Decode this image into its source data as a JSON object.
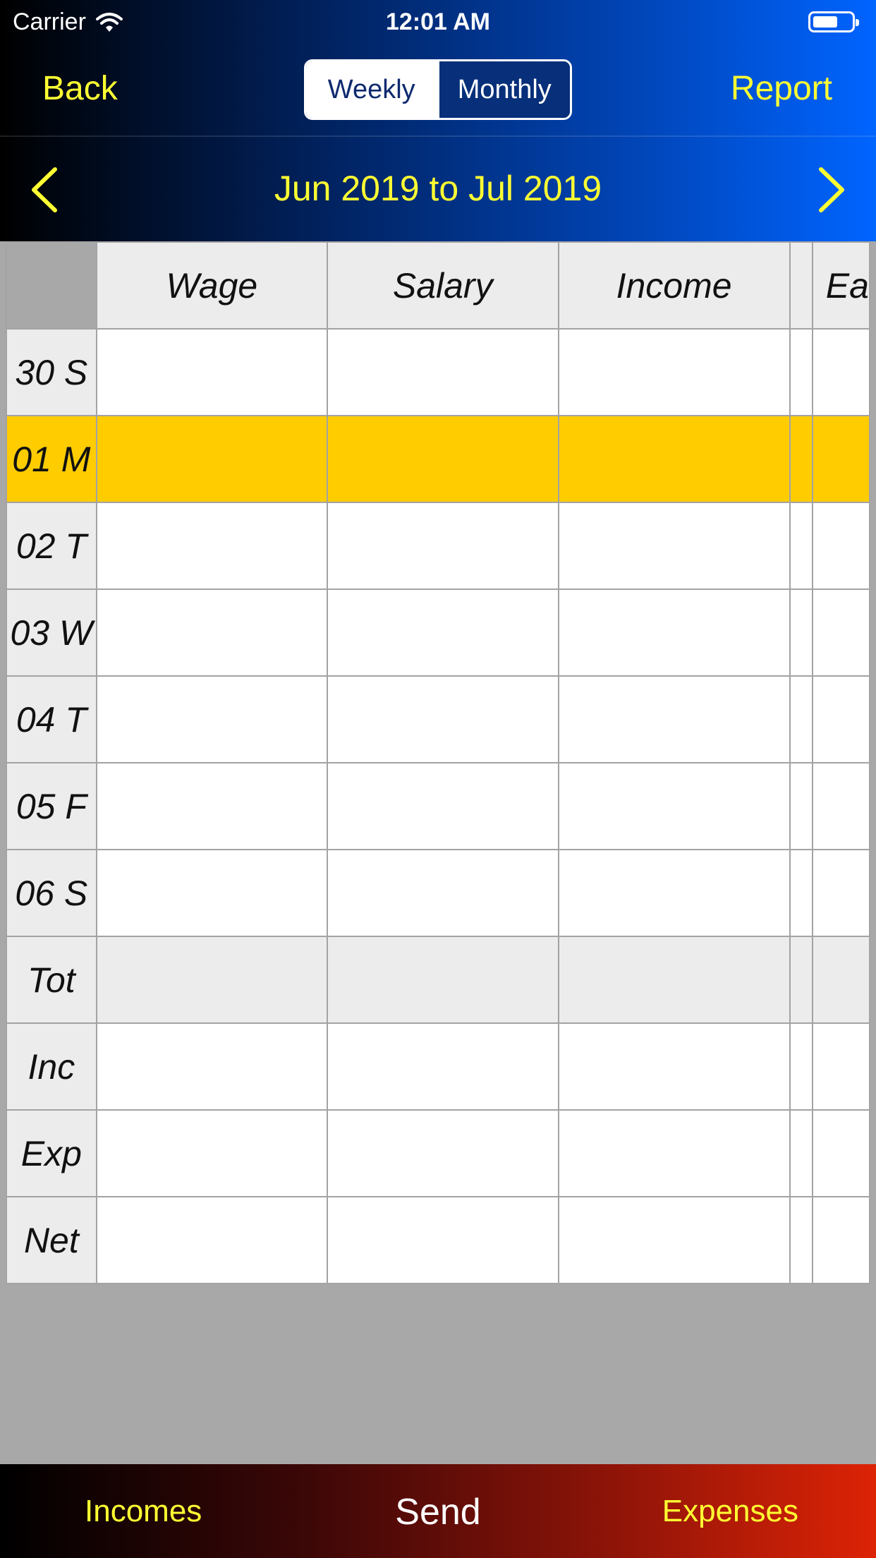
{
  "status_bar": {
    "carrier": "Carrier",
    "time": "12:01 AM"
  },
  "nav": {
    "back_label": "Back",
    "report_label": "Report",
    "segments": [
      "Weekly",
      "Monthly"
    ],
    "selected_segment": "Weekly"
  },
  "period": {
    "title": "Jun 2019 to Jul 2019"
  },
  "grid": {
    "columns": [
      "Wage",
      "Salary",
      "Income",
      "",
      "Ea"
    ],
    "rows": [
      {
        "label": "30 S",
        "highlighted": false
      },
      {
        "label": "01 M",
        "highlighted": true
      },
      {
        "label": "02 T",
        "highlighted": false
      },
      {
        "label": "03 W",
        "highlighted": false
      },
      {
        "label": "04 T",
        "highlighted": false
      },
      {
        "label": "05 F",
        "highlighted": false
      },
      {
        "label": "06 S",
        "highlighted": false
      },
      {
        "label": "Tot",
        "highlighted": false
      },
      {
        "label": "Inc",
        "highlighted": false
      },
      {
        "label": "Exp",
        "highlighted": false
      },
      {
        "label": "Net",
        "highlighted": false
      }
    ],
    "highlight_color": "#ffcc00"
  },
  "tabbar": {
    "incomes_label": "Incomes",
    "send_label": "Send",
    "expenses_label": "Expenses"
  },
  "colors": {
    "accent_yellow": "#ffff33",
    "header_blue": "#0064ff",
    "tabbar_red": "#dd2306"
  }
}
